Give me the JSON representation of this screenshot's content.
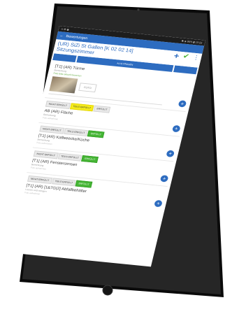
{
  "statusbar": {
    "left": "≡ ⚙ ◉",
    "right": "✱ ◈ 96% ▮ 10:22"
  },
  "toolbar": {
    "title": "Bewertungen"
  },
  "room": {
    "title": "(UR) SiZi St Gallen  [K 02 02 14]",
    "subtitle": "Sitzungszimmer"
  },
  "tabs": [
    "",
    "ALLE FRAGEN",
    ""
  ],
  "choices": {
    "not_met": "NICHT ERFÜLLT",
    "partial": "TEILS ERFÜLLT",
    "met": "ERFÜLLT"
  },
  "items": [
    {
      "name": "[T1] (AR) Türme",
      "sub": "Bemerkung",
      "green_hint": "Foto bitte aktuell bewerten",
      "photo_button": "FOTO",
      "state": "none"
    },
    {
      "name": "AB (AR) Fläche",
      "sub": "Bemerkung",
      "note": "Foto aufnehmen",
      "state": "partial"
    },
    {
      "name": "[T1] (AR) Kaffeeecke/Küche",
      "sub": "Bemerkung",
      "note": "Foto aufnehmen",
      "state": "met"
    },
    {
      "name": "[T1] (AR) Fenstersimsen",
      "sub": "Bemerkung",
      "note": "Foto aufnehmen",
      "state": "met"
    },
    {
      "name": "[T1] (AR) [1&7G(2] Abfallbehälter",
      "sub": "Leeren und reinigen",
      "note": "Foto aufnehmen",
      "state": "met"
    }
  ],
  "colors": {
    "accent": "#2d6cc0",
    "partial": "#f5ec1d",
    "met": "#45b535"
  }
}
